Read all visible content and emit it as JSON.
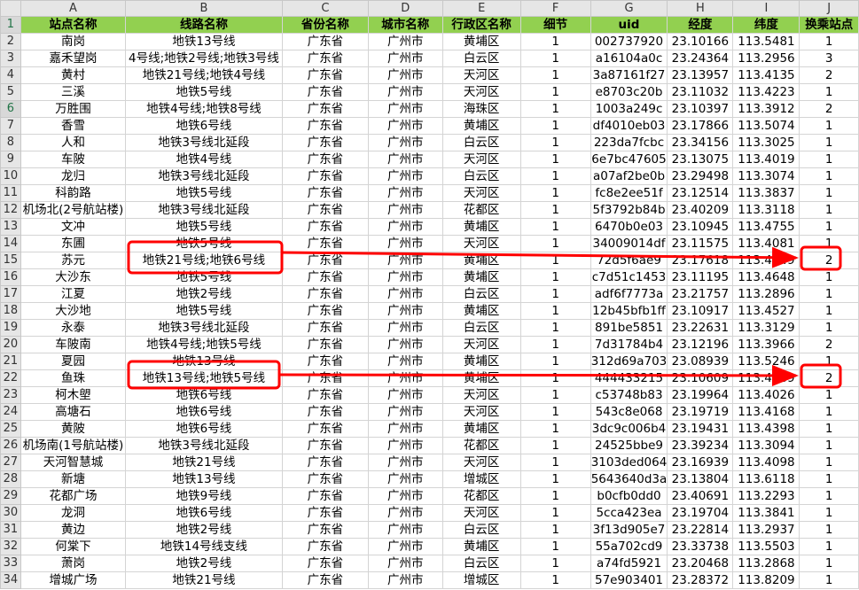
{
  "columns": [
    "A",
    "B",
    "C",
    "D",
    "E",
    "F",
    "G",
    "H",
    "I",
    "J"
  ],
  "headers": [
    "站点名称",
    "线路名称",
    "省份名称",
    "城市名称",
    "行政区名称",
    "细节",
    "uid",
    "经度",
    "纬度",
    "换乘站点"
  ],
  "rows": [
    [
      "南岗",
      "地铁13号线",
      "广东省",
      "广州市",
      "黄埔区",
      "1",
      "002737920",
      "23.10166",
      "113.5481",
      "1"
    ],
    [
      "嘉禾望岗",
      "4号线;地铁2号线;地铁3号线",
      "广东省",
      "广州市",
      "白云区",
      "1",
      "a16104a0c",
      "23.24364",
      "113.2956",
      "3"
    ],
    [
      "黄村",
      "地铁21号线;地铁4号线",
      "广东省",
      "广州市",
      "天河区",
      "1",
      "3a87161f27",
      "23.13957",
      "113.4135",
      "2"
    ],
    [
      "三溪",
      "地铁5号线",
      "广东省",
      "广州市",
      "天河区",
      "1",
      "e8703c20b",
      "23.11032",
      "113.4223",
      "1"
    ],
    [
      "万胜围",
      "地铁4号线;地铁8号线",
      "广东省",
      "广州市",
      "海珠区",
      "1",
      "1003a249c",
      "23.10397",
      "113.3912",
      "2"
    ],
    [
      "香雪",
      "地铁6号线",
      "广东省",
      "广州市",
      "黄埔区",
      "1",
      "df4010eb03",
      "23.17866",
      "113.5074",
      "1"
    ],
    [
      "人和",
      "地铁3号线北延段",
      "广东省",
      "广州市",
      "白云区",
      "1",
      "223da7fcbc",
      "23.34156",
      "113.3025",
      "1"
    ],
    [
      "车陂",
      "地铁4号线",
      "广东省",
      "广州市",
      "天河区",
      "1",
      "6e7bc47605",
      "23.13075",
      "113.4019",
      "1"
    ],
    [
      "龙归",
      "地铁3号线北延段",
      "广东省",
      "广州市",
      "白云区",
      "1",
      "a07af2be0b",
      "23.29498",
      "113.3074",
      "1"
    ],
    [
      "科韵路",
      "地铁5号线",
      "广东省",
      "广州市",
      "天河区",
      "1",
      "fc8e2ee51f",
      "23.12514",
      "113.3837",
      "1"
    ],
    [
      "机场北(2号航站楼)",
      "地铁3号线北延段",
      "广东省",
      "广州市",
      "花都区",
      "1",
      "5f3792b84b",
      "23.40209",
      "113.3118",
      "1"
    ],
    [
      "文冲",
      "地铁5号线",
      "广东省",
      "广州市",
      "黄埔区",
      "1",
      "6470b0e03",
      "23.10945",
      "113.4755",
      "1"
    ],
    [
      "东圃",
      "地铁5号线",
      "广东省",
      "广州市",
      "天河区",
      "1",
      "34009014df",
      "23.11575",
      "113.4081",
      "1"
    ],
    [
      "苏元",
      "地铁21号线;地铁6号线",
      "广东省",
      "广州市",
      "黄埔区",
      "1",
      "72d5f6ae9",
      "23.17618",
      "113.4749",
      "2"
    ],
    [
      "大沙东",
      "地铁5号线",
      "广东省",
      "广州市",
      "黄埔区",
      "1",
      "c7d51c1453",
      "23.11195",
      "113.4648",
      "1"
    ],
    [
      "江夏",
      "地铁2号线",
      "广东省",
      "广州市",
      "白云区",
      "1",
      "adf6f7773a",
      "23.21757",
      "113.2896",
      "1"
    ],
    [
      "大沙地",
      "地铁5号线",
      "广东省",
      "广州市",
      "黄埔区",
      "1",
      "12b45bfb1ff",
      "23.10917",
      "113.4527",
      "1"
    ],
    [
      "永泰",
      "地铁3号线北延段",
      "广东省",
      "广州市",
      "白云区",
      "1",
      "891be5851",
      "23.22631",
      "113.3129",
      "1"
    ],
    [
      "车陂南",
      "地铁4号线;地铁5号线",
      "广东省",
      "广州市",
      "天河区",
      "1",
      "7d31784b4",
      "23.12196",
      "113.3966",
      "2"
    ],
    [
      "夏园",
      "地铁13号线",
      "广东省",
      "广州市",
      "黄埔区",
      "1",
      "312d69a703",
      "23.08939",
      "113.5246",
      "1"
    ],
    [
      "鱼珠",
      "地铁13号线;地铁5号线",
      "广东省",
      "广州市",
      "黄埔区",
      "1",
      "444433215",
      "23.10609",
      "113.4469",
      "2"
    ],
    [
      "柯木塱",
      "地铁6号线",
      "广东省",
      "广州市",
      "天河区",
      "1",
      "c53748b83",
      "23.19964",
      "113.4026",
      "1"
    ],
    [
      "高塘石",
      "地铁6号线",
      "广东省",
      "广州市",
      "天河区",
      "1",
      "543c8e068",
      "23.19719",
      "113.4168",
      "1"
    ],
    [
      "黄陂",
      "地铁6号线",
      "广东省",
      "广州市",
      "黄埔区",
      "1",
      "3dc9c006b4",
      "23.19431",
      "113.4398",
      "1"
    ],
    [
      "机场南(1号航站楼)",
      "地铁3号线北延段",
      "广东省",
      "广州市",
      "花都区",
      "1",
      "24525bbe9",
      "23.39234",
      "113.3094",
      "1"
    ],
    [
      "天河智慧城",
      "地铁21号线",
      "广东省",
      "广州市",
      "天河区",
      "1",
      "3103ded064",
      "23.16939",
      "113.4098",
      "1"
    ],
    [
      "新塘",
      "地铁13号线",
      "广东省",
      "广州市",
      "增城区",
      "1",
      "5643640d3a",
      "23.13804",
      "113.6118",
      "1"
    ],
    [
      "花都广场",
      "地铁9号线",
      "广东省",
      "广州市",
      "花都区",
      "1",
      "b0cfb0dd0",
      "23.40691",
      "113.2293",
      "1"
    ],
    [
      "龙洞",
      "地铁6号线",
      "广东省",
      "广州市",
      "天河区",
      "1",
      "5cca423ea",
      "23.19704",
      "113.3841",
      "1"
    ],
    [
      "黄边",
      "地铁2号线",
      "广东省",
      "广州市",
      "白云区",
      "1",
      "3f13d905e7",
      "23.22814",
      "113.2937",
      "1"
    ],
    [
      "何棠下",
      "地铁14号线支线",
      "广东省",
      "广州市",
      "黄埔区",
      "1",
      "55a702cd9",
      "23.33738",
      "113.5503",
      "1"
    ],
    [
      "萧岗",
      "地铁2号线",
      "广东省",
      "广州市",
      "白云区",
      "1",
      "a74fd5921",
      "23.20468",
      "113.2868",
      "1"
    ],
    [
      "增城广场",
      "地铁21号线",
      "广东省",
      "广州市",
      "增城区",
      "1",
      "57e903401",
      "23.28372",
      "113.8209",
      "1"
    ]
  ],
  "annotations": {
    "color": "#ff0000",
    "highlights": [
      {
        "row": 15,
        "from_col": "B",
        "to_col": "J",
        "values": [
          "地铁21号线;地铁6号线",
          "2"
        ]
      },
      {
        "row": 22,
        "from_col": "B",
        "to_col": "J",
        "values": [
          "地铁13号线;地铁5号线",
          "2"
        ]
      }
    ]
  },
  "colors": {
    "header_fill": "#92d050",
    "chrome": "#e6e6e6",
    "gridline": "#d4d4d4"
  }
}
